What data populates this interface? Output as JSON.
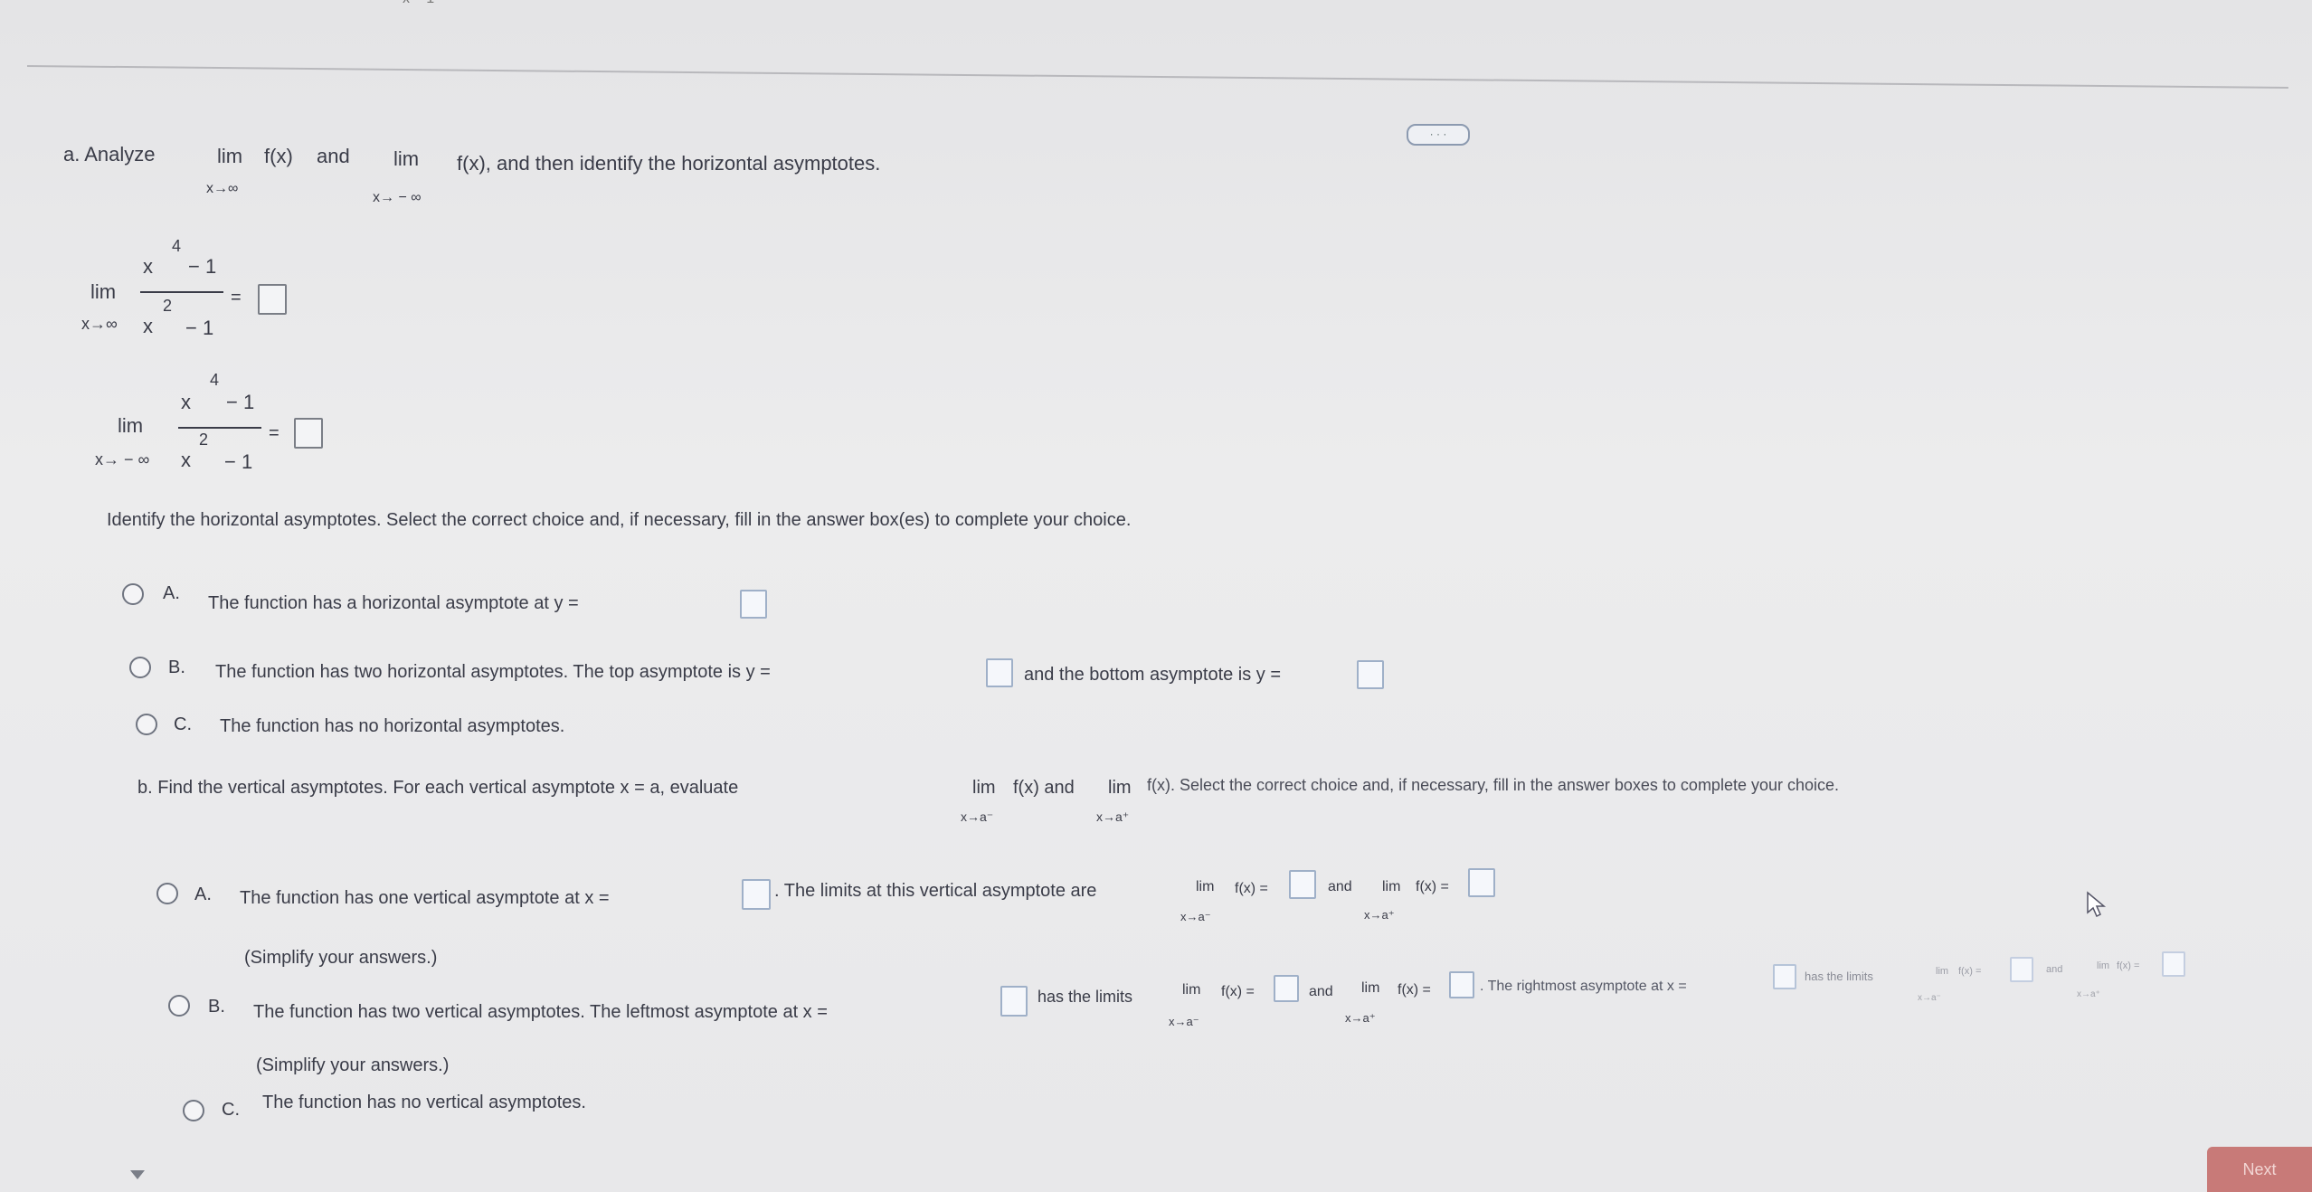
{
  "top_fragment": "x − 1",
  "more_button": "· · ·",
  "part_a": {
    "analyze": "a. Analyze",
    "lim": "lim",
    "fx": "f(x)",
    "and": "and",
    "sub_inf": "x→∞",
    "sub_neginf": "x→ − ∞",
    "tail": "f(x), and then identify the horizontal asymptotes."
  },
  "limits": {
    "lim": "lim",
    "sub_pos": "x→∞",
    "sub_neg": "x→ − ∞",
    "num": "x",
    "num_exp": "4",
    "num_tail": "− 1",
    "den": "x",
    "den_exp": "2",
    "den_tail": "− 1",
    "equals": "="
  },
  "identify_text": "Identify the horizontal asymptotes. Select the correct choice and, if necessary, fill in the answer box(es) to complete your choice.",
  "h_choices": {
    "a_letter": "A.",
    "a_text": "The function has a horizontal asymptote at y =",
    "b_letter": "B.",
    "b_text1": "The function has two horizontal asymptotes. The top asymptote is y =",
    "b_text2": "and the bottom asymptote is y =",
    "c_letter": "C.",
    "c_text": "The function has no horizontal asymptotes."
  },
  "part_b": {
    "text1": "b. Find the vertical asymptotes. For each vertical asymptote x = a, evaluate",
    "lim": "lim",
    "fx_and": "f(x) and",
    "fx_tail": "f(x). Select the correct choice and, if necessary, fill in the answer boxes to complete your choice.",
    "sub_minus": "x→a⁻",
    "sub_plus": "x→a⁺"
  },
  "v_choices": {
    "a_letter": "A.",
    "a_text1": "The function has one vertical asymptote at x =",
    "a_text2": ". The limits at this vertical asymptote are",
    "lim": "lim",
    "fx_eq": "f(x) =",
    "and": "and",
    "sub_minus": "x→a⁻",
    "sub_plus": "x→a⁺",
    "simplify": "(Simplify your answers.)",
    "b_letter": "B.",
    "b_text1": "The function has two vertical asymptotes. The leftmost asymptote at x =",
    "b_text2": "has the limits",
    "b_text3": ". The rightmost asymptote at x =",
    "b_text4": "has the limits",
    "c_letter": "C.",
    "c_text": "The function has no vertical asymptotes."
  },
  "next_button": "Next"
}
